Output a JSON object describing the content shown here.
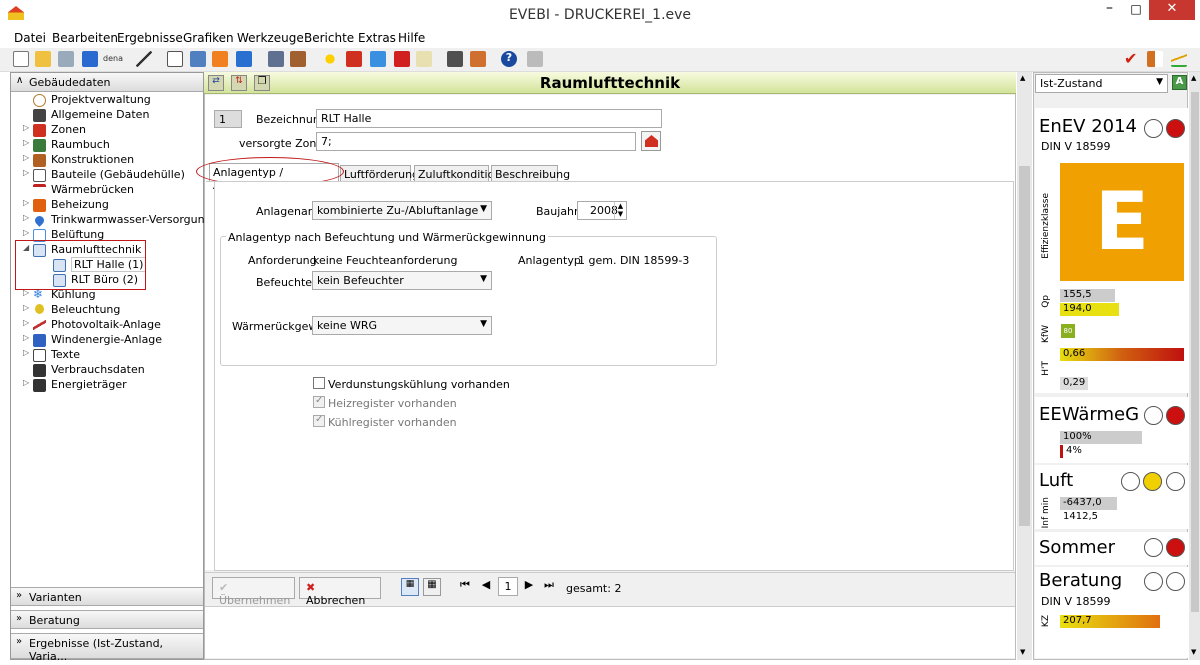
{
  "window": {
    "title": "EVEBI - DRUCKEREI_1.eve"
  },
  "menu": [
    "Datei",
    "Bearbeiten",
    "Ergebnisse",
    "Grafiken",
    "Werkzeuge",
    "Berichte",
    "Extras",
    "Hilfe"
  ],
  "toolbar": {
    "dena_label": "dena"
  },
  "left": {
    "header": "Gebäudedaten",
    "tree": [
      {
        "label": "Projektverwaltung",
        "color": "#b07a2a"
      },
      {
        "label": "Allgemeine Daten",
        "color": "#444"
      },
      {
        "label": "Zonen",
        "color": "#d03020"
      },
      {
        "label": "Raumbuch",
        "color": "#3a7a3a"
      },
      {
        "label": "Konstruktionen",
        "color": "#b06020"
      },
      {
        "label": "Bauteile (Gebäudehülle)",
        "color": "#555"
      },
      {
        "label": "Wärmebrücken",
        "color": "#c02020"
      },
      {
        "label": "Beheizung",
        "color": "#e06010"
      },
      {
        "label": "Trinkwarmwasser-Versorgung",
        "color": "#3070d0"
      },
      {
        "label": "Belüftung",
        "color": "#5090e0"
      },
      {
        "label": "Raumlufttechnik",
        "color": "#4070b0"
      },
      {
        "label": "RLT Halle (1)",
        "color": "#4070b0"
      },
      {
        "label": "RLT Büro (2)",
        "color": "#4070b0"
      },
      {
        "label": "Kühlung",
        "color": "#3080e0"
      },
      {
        "label": "Beleuchtung",
        "color": "#e0c020"
      },
      {
        "label": "Photovoltaik-Anlage",
        "color": "#c03030"
      },
      {
        "label": "Windenergie-Anlage",
        "color": "#3060c0"
      },
      {
        "label": "Texte",
        "color": "#444"
      },
      {
        "label": "Verbrauchsdaten",
        "color": "#333"
      },
      {
        "label": "Energieträger",
        "color": "#333"
      }
    ],
    "footer": [
      "Varianten",
      "Beratung",
      "Ergebnisse (Ist-Zustand, Varia..."
    ]
  },
  "main": {
    "title": "Raumlufttechnik",
    "number": "1",
    "bezeichnung_label": "Bezeichnung",
    "bezeichnung_value": "RLT Halle",
    "zonen_label": "versorgte Zonen",
    "zonen_value": "7;",
    "tabs": [
      "Anlagentyp / Arbeitsprinzip",
      "Luftförderung",
      "Zuluftkondition",
      "Beschreibung"
    ],
    "anlagenart_label": "Anlagenart",
    "anlagenart_value": "kombinierte Zu-/Abluftanlage",
    "baujahr_label": "Baujahr",
    "baujahr_value": "2008",
    "group_title": "Anlagentyp nach Befeuchtung und Wärmerückgewinnung",
    "anforderung_label": "Anforderung",
    "anforderung_value": "keine Feuchteanforderung",
    "anlagentyp_label": "Anlagentyp",
    "anlagentyp_value": "1 gem. DIN 18599-3",
    "befeuchter_label": "Befeuchter",
    "befeuchter_value": "kein Befeuchter",
    "wrg_label": "Wärmerückgew.",
    "wrg_value": "keine WRG",
    "cb1": "Verdunstungskühlung vorhanden",
    "cb2": "Heizregister vorhanden",
    "cb3": "Kühlregister vorhanden",
    "btn_apply": "Übernehmen",
    "btn_cancel": "Abbrechen",
    "nav_page": "1",
    "total": "gesamt: 2"
  },
  "right": {
    "state_select": "Ist-Zustand",
    "enev_title": "EnEV 2014",
    "din": "DIN V 18599",
    "effizienz_label": "Effizienzklasse",
    "eff_class": "E",
    "qp_label": "Qp",
    "qp1": "155,5",
    "qp2": "194,0",
    "kfw_label": "KfW",
    "kfw": "80",
    "ht_label": "H'T",
    "ht1": "0,66",
    "ht2": "0,29",
    "ee_title": "EEWärmeG",
    "ee1": "100%",
    "ee2": "4%",
    "luft_title": "Luft",
    "inf_label": "Inf min",
    "luft1": "-6437,0",
    "luft2": "1412,5",
    "sommer_title": "Sommer",
    "beratung_title": "Beratung",
    "beratung_din": "DIN V 18599",
    "kz_label": "KZ",
    "beratung_val": "207,7"
  }
}
